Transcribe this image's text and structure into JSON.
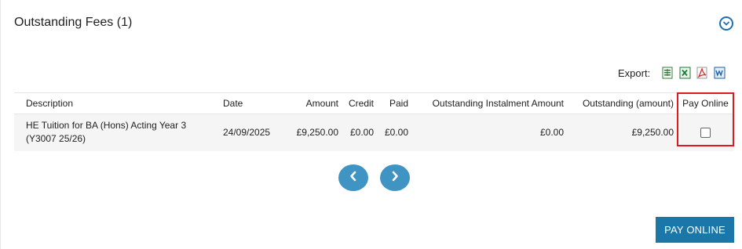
{
  "section": {
    "title": "Outstanding Fees (1)"
  },
  "export": {
    "label": "Export:",
    "icons": [
      "csv-icon",
      "excel-icon",
      "pdf-icon",
      "word-icon"
    ]
  },
  "table": {
    "headers": {
      "description": "Description",
      "date": "Date",
      "amount": "Amount",
      "credit": "Credit",
      "paid": "Paid",
      "outstanding_instalment": "Outstanding Instalment Amount",
      "outstanding_amount": "Outstanding (amount)",
      "pay_online": "Pay Online"
    },
    "rows": [
      {
        "description": "HE Tuition for BA (Hons) Acting Year 3 (Y3007 25/26)",
        "date": "24/09/2025",
        "amount": "£9,250.00",
        "credit": "£0.00",
        "paid": "£0.00",
        "outstanding_instalment": "£0.00",
        "outstanding_amount": "£9,250.00",
        "pay_online_checked": false
      }
    ]
  },
  "pagination": {
    "prev_icon": "chevron-left-icon",
    "next_icon": "chevron-right-icon"
  },
  "actions": {
    "pay_online_label": "PAY ONLINE"
  },
  "colors": {
    "accent": "#3f94c4",
    "button": "#1a77a8",
    "highlight": "#e0191f",
    "row_bg": "#f5f5f5"
  }
}
